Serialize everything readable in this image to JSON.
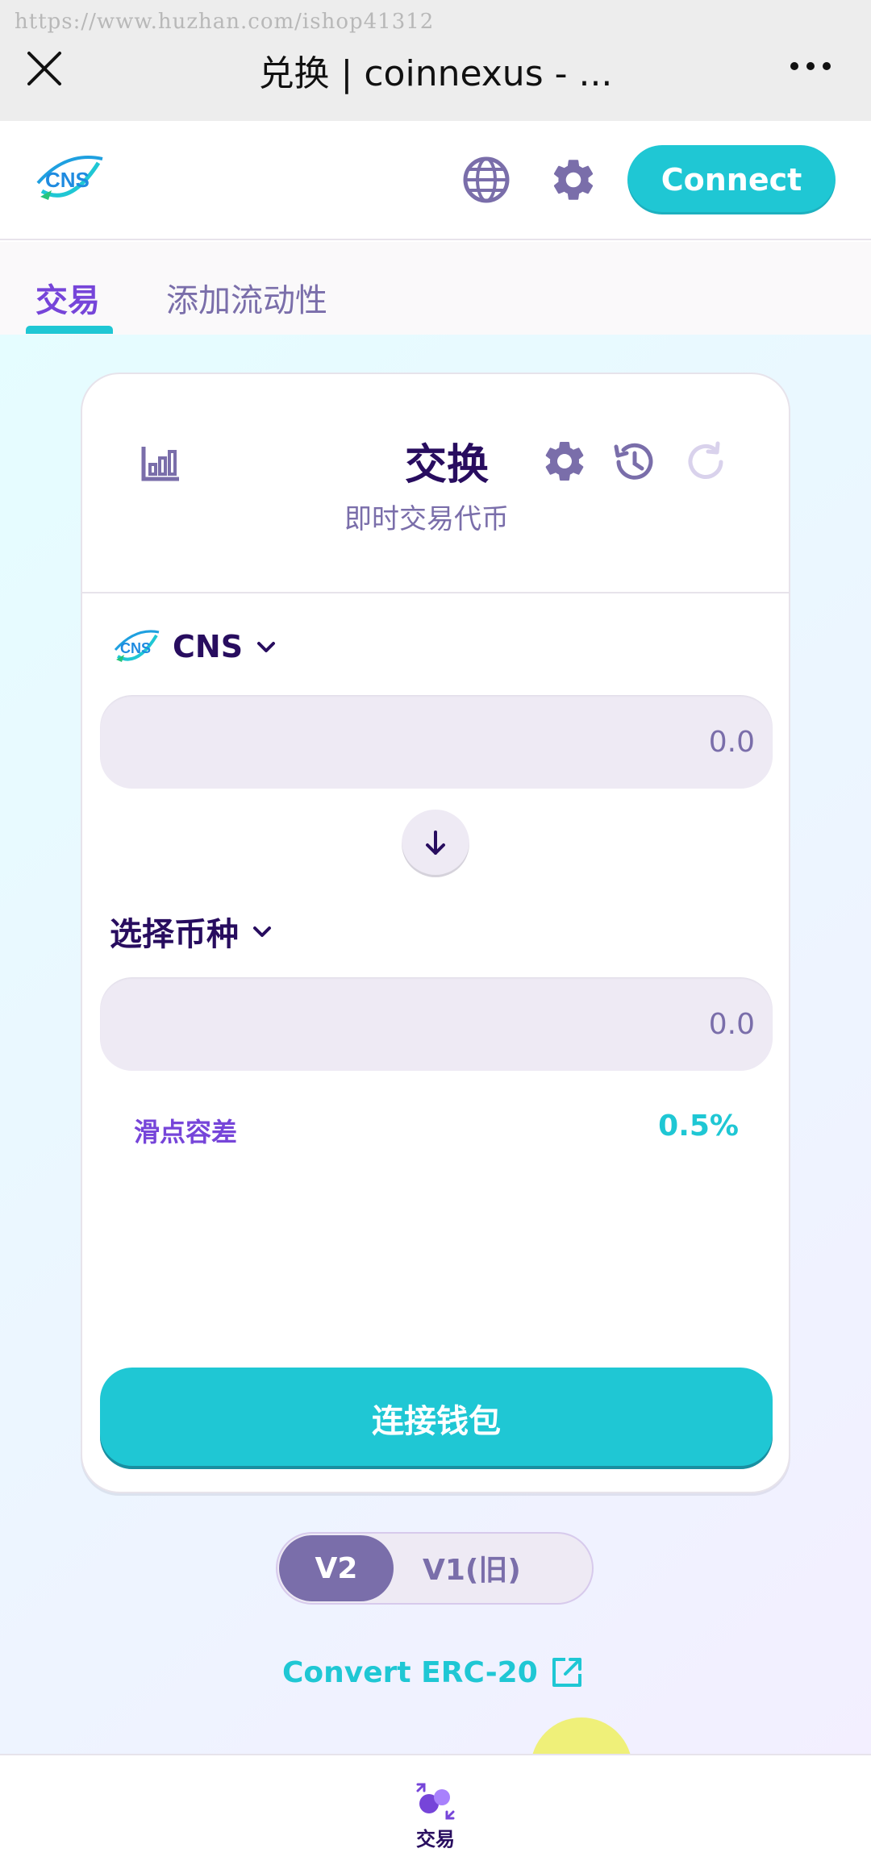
{
  "browser": {
    "watermark": "https://www.huzhan.com/ishop41312",
    "title": "兑换 | coinnexus - ..."
  },
  "header": {
    "connect_label": "Connect"
  },
  "subnav": {
    "tabs": [
      {
        "label": "交易",
        "active": true
      },
      {
        "label": "添加流动性",
        "active": false
      }
    ]
  },
  "swap_card": {
    "title": "交换",
    "subtitle": "即时交易代币",
    "from": {
      "token": "CNS",
      "amount_placeholder": "0.0"
    },
    "to": {
      "token_select_label": "选择币种",
      "amount_placeholder": "0.0"
    },
    "slippage": {
      "label": "滑点容差",
      "value": "0.5%"
    },
    "connect_wallet_label": "连接钱包"
  },
  "version_toggle": {
    "v2_label": "V2",
    "v1_label": "V1(旧)",
    "selected": "V2"
  },
  "convert_link": "Convert ERC-20",
  "bottom_nav": {
    "items": [
      {
        "label": "交易"
      }
    ]
  },
  "colors": {
    "primary": "#1fc7d4",
    "secondary": "#7645d9",
    "text": "#280d5f",
    "text_subtle": "#7a6eaa",
    "input_bg": "#eeeaf4"
  }
}
